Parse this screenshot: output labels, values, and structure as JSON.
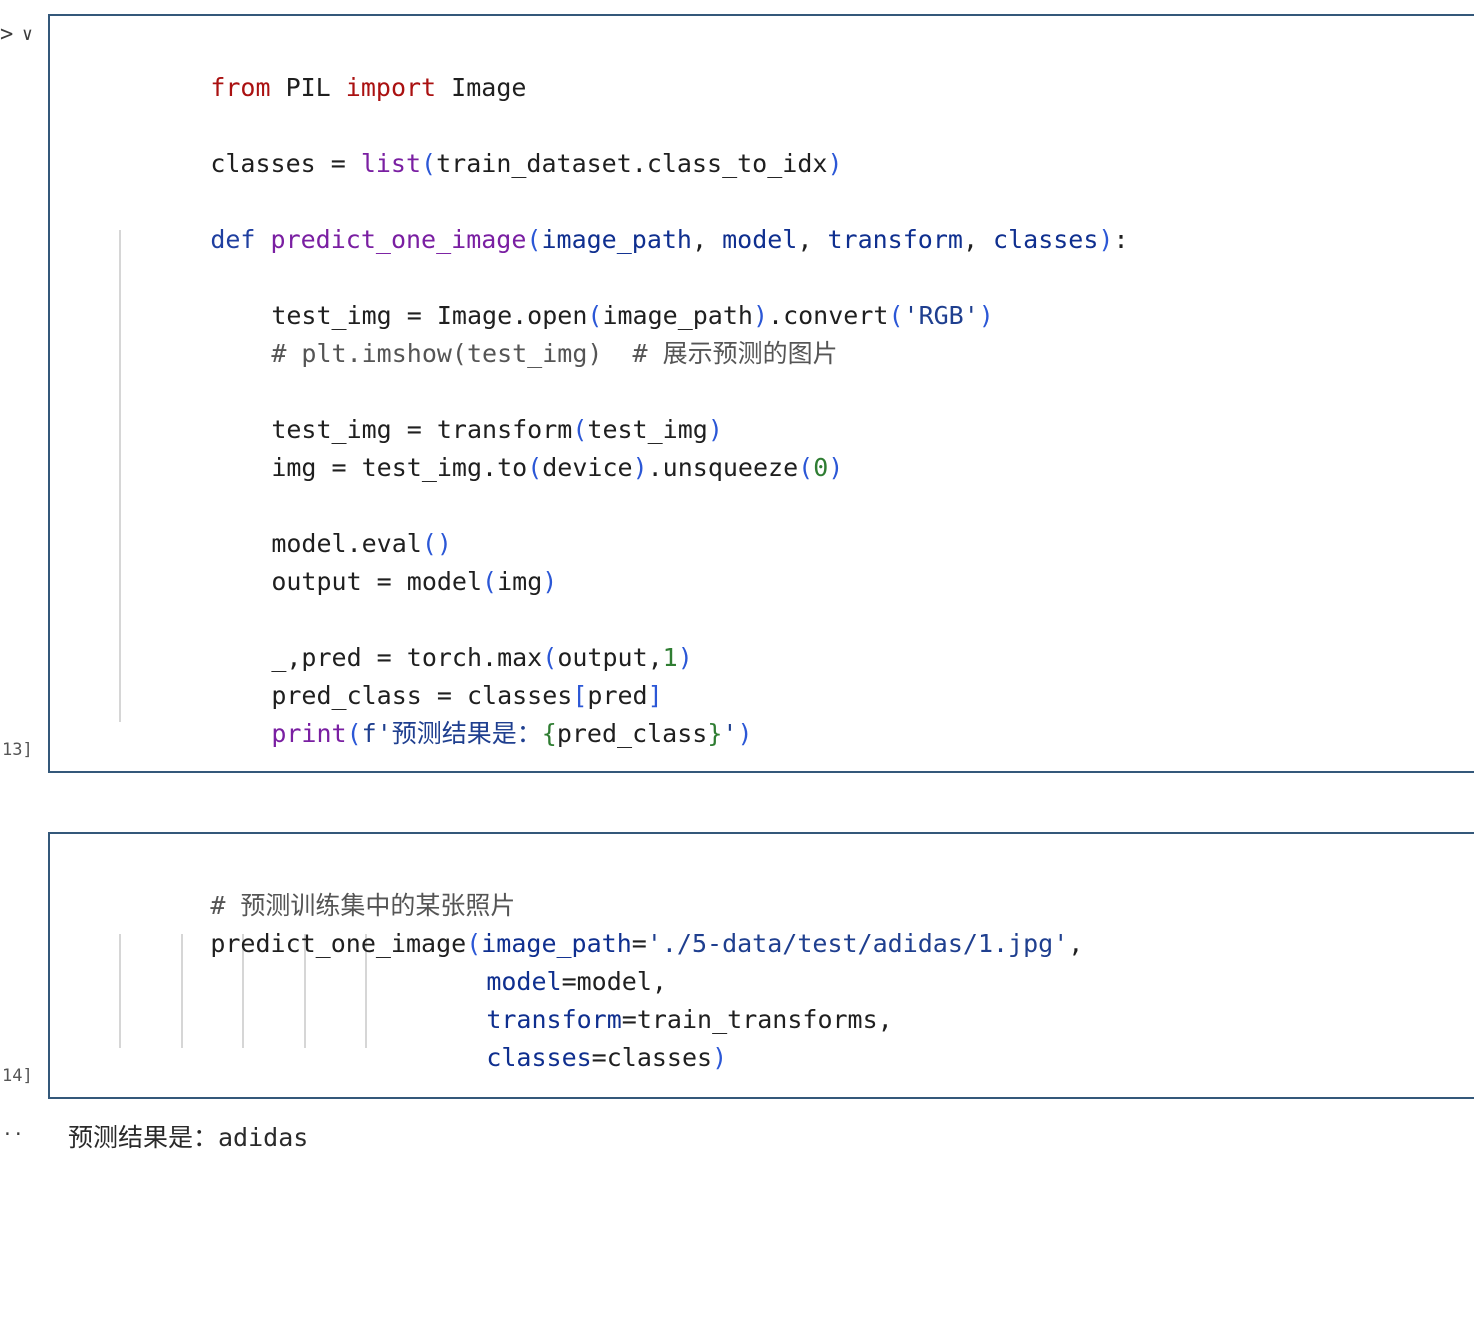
{
  "gutter": {
    "chevron_right": ">",
    "chevron_down": "∨",
    "output_dots": "··"
  },
  "cell1": {
    "exec_count": "13]",
    "lines": {
      "l1": [
        "from",
        " PIL ",
        "import",
        " Image"
      ],
      "l2": [
        "classes = ",
        "list",
        "(",
        "train_dataset.class_to_idx",
        ")"
      ],
      "l3": [
        "def",
        " ",
        "predict_one_image",
        "(",
        "image_path",
        ", ",
        "model",
        ", ",
        "transform",
        ", ",
        "classes",
        ")",
        ":"
      ],
      "l4": [
        "test_img = Image.open",
        "(",
        "image_path",
        ")",
        ".convert",
        "(",
        "'RGB'",
        ")"
      ],
      "l5": [
        "# plt.imshow(test_img)  # 展示预测的图片"
      ],
      "l6": [
        "test_img = transform",
        "(",
        "test_img",
        ")"
      ],
      "l7": [
        "img = test_img.to",
        "(",
        "device",
        ")",
        ".unsqueeze",
        "(",
        "0",
        ")"
      ],
      "l8": [
        "model.eval",
        "()"
      ],
      "l9": [
        "output = model",
        "(",
        "img",
        ")"
      ],
      "l10": [
        "_,pred = torch.max",
        "(",
        "output,",
        "1",
        ")"
      ],
      "l11": [
        "pred_class = classes",
        "[",
        "pred",
        "]"
      ],
      "l12": [
        "print",
        "(",
        "f'预测结果是：",
        "{",
        "pred_class",
        "}",
        "'",
        ")"
      ]
    }
  },
  "cell2": {
    "exec_count": "14]",
    "lines": {
      "l1": [
        "# 预测训练集中的某张照片"
      ],
      "l2": [
        "predict_one_image",
        "(",
        "image_path",
        "=",
        "'./5-data/test/adidas/1.jpg'",
        ","
      ],
      "l3": [
        "model",
        "=model,"
      ],
      "l4": [
        "transform",
        "=train_transforms,"
      ],
      "l5": [
        "classes",
        "=classes",
        ")"
      ]
    }
  },
  "output": {
    "text": "预测结果是：adidas"
  }
}
